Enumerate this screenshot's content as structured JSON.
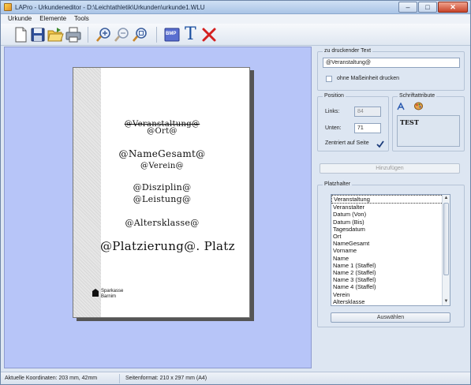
{
  "window": {
    "title": "LAPro - Urkundeneditor - D:\\Leichtathletik\\Urkunden\\urkunde1.WLU",
    "controls": {
      "minimize": "–",
      "maximize": "□",
      "close": "✕"
    }
  },
  "menu": [
    "Urkunde",
    "Elemente",
    "Tools"
  ],
  "toolbar": {
    "buttons": [
      "new-document-icon",
      "save-icon",
      "open-folder-icon",
      "print-icon",
      "zoom-in-icon",
      "zoom-out-icon",
      "zoom-fit-icon",
      "bitmap-icon",
      "text-icon",
      "delete-icon"
    ],
    "bmp_label": "BMP",
    "text_glyph": "T"
  },
  "document": {
    "placeholders": [
      {
        "text": "@Veranstaltung@",
        "style": "strike"
      },
      {
        "text": "@Ort@"
      },
      {
        "text": "@NameGesamt@"
      },
      {
        "text": "@Verein@"
      },
      {
        "text": "@Disziplin@"
      },
      {
        "text": "@Leistung@"
      },
      {
        "text": "@Altersklasse@"
      },
      {
        "text": "@Platzierung@. Platz"
      }
    ],
    "logo_lines": [
      "Sparkasse",
      "Barnim"
    ]
  },
  "print_text": {
    "title": "zu druckender Text",
    "value": "@Veranstaltung@",
    "no_units_label": "ohne Maßeinheit drucken"
  },
  "position": {
    "title": "Position",
    "left_label": "Links:",
    "left_value": "84",
    "bottom_label": "Unten:",
    "bottom_value": "71",
    "centered_label": "Zentriert auf Seite",
    "centered_checked": true
  },
  "font_attrs": {
    "title": "Schriftattribute",
    "preview": "TEST"
  },
  "add_button": "Hinzufügen",
  "placeholders": {
    "title": "Platzhalter",
    "items": [
      "Veranstaltung",
      "Veranstalter",
      "Datum (Von)",
      "Datum (Bis)",
      "Tagesdatum",
      "Ort",
      "NameGesamt",
      "Vorname",
      "Name",
      "Name 1 (Staffel)",
      "Name 2 (Staffel)",
      "Name 3 (Staffel)",
      "Name 4 (Staffel)",
      "Verein",
      "Altersklasse"
    ],
    "select_button": "Auswählen"
  },
  "status": {
    "coords": "Aktuelle Koordinaten: 203 mm, 42mm",
    "format": "Seitenformat: 210 x 297 mm (A4)"
  },
  "colors": {
    "canvas_bg": "#b7c5f8",
    "delete_red": "#d42020",
    "text_tool_blue": "#1a4fa0"
  }
}
